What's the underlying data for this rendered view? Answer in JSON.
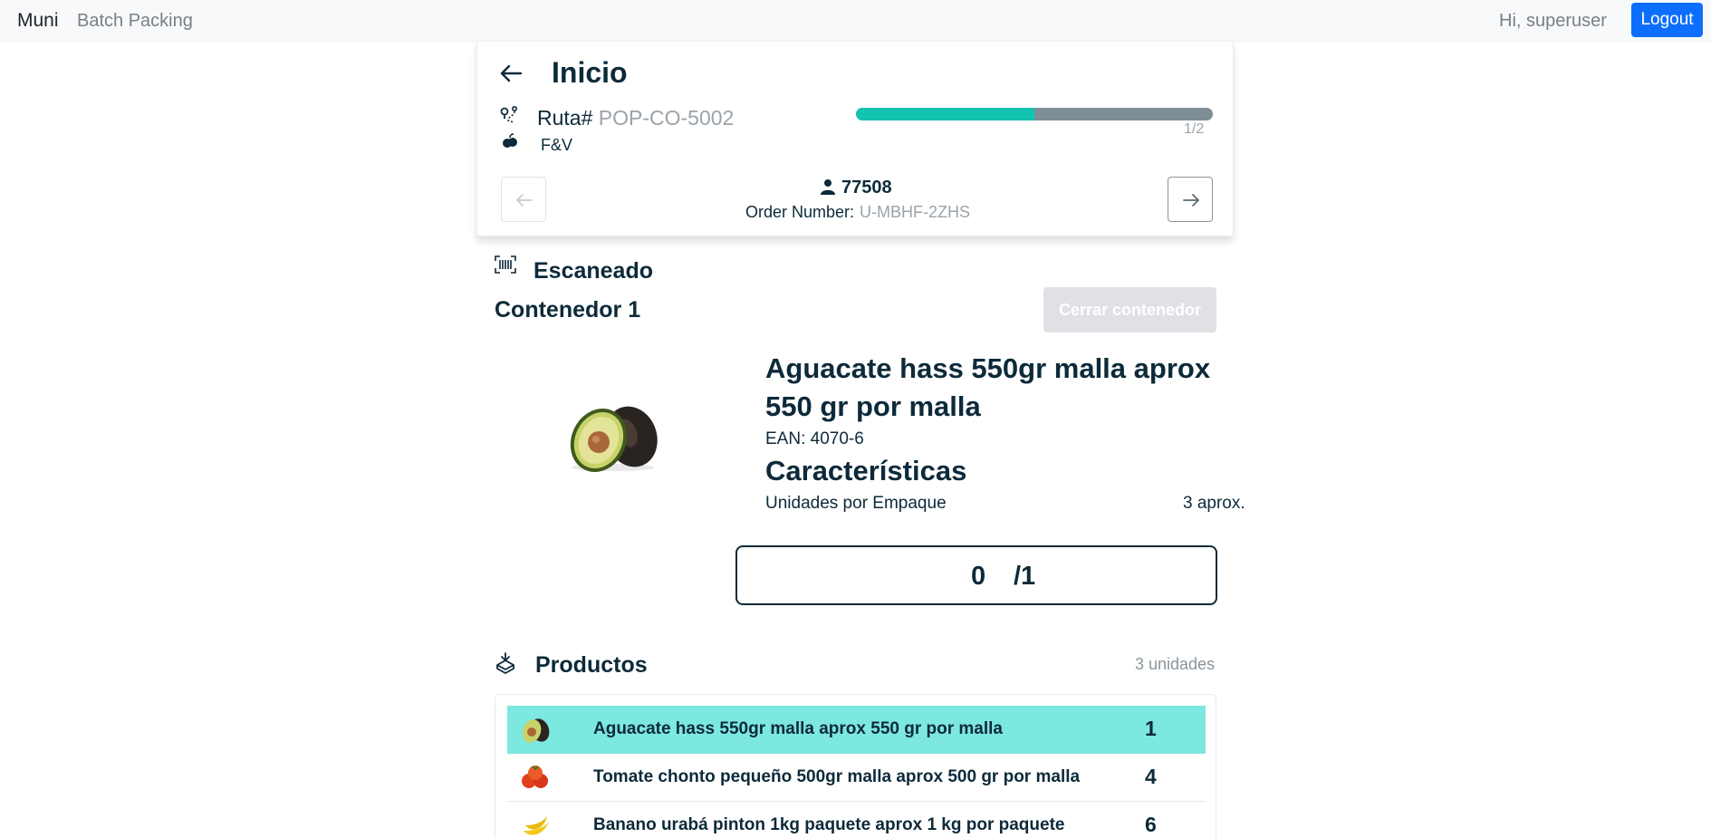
{
  "navbar": {
    "brand": "Muni",
    "link": "Batch Packing",
    "greeting": "Hi, superuser",
    "logout_label": "Logout"
  },
  "header": {
    "title": "Inicio",
    "route_label": "Ruta#",
    "route_value": "POP-CO-5002",
    "category": "F&V",
    "progress": {
      "current": 1,
      "total": 2,
      "fraction": 0.5,
      "text": "1/2"
    },
    "customer_id": "77508",
    "order_label": "Order Number:",
    "order_value": "U-MBHF-2ZHS"
  },
  "scan": {
    "title": "Escaneado",
    "container_title": "Contenedor 1",
    "close_label": "Cerrar contenedor",
    "product": {
      "name": "Aguacate hass 550gr malla aprox 550 gr por malla",
      "ean": "EAN: 4070-6",
      "features_title": "Características",
      "feature_label": "Unidades por Empaque",
      "feature_value": "3 aprox."
    },
    "counter": {
      "current": "0",
      "total": "/1"
    }
  },
  "products": {
    "title": "Productos",
    "count": "3 unidades",
    "items": [
      {
        "name": "Aguacate hass 550gr malla aprox 550 gr por malla",
        "qty": "1",
        "icon": "avocado-icon"
      },
      {
        "name": "Tomate chonto pequeño 500gr malla aprox 500 gr por malla",
        "qty": "4",
        "icon": "tomato-icon"
      },
      {
        "name": "Banano urabá pinton 1kg paquete aprox 1 kg por paquete",
        "qty": "6",
        "icon": "banana-icon"
      }
    ]
  },
  "colors": {
    "navy": "#0d2a3a",
    "teal": "#12c4b0",
    "highlight": "#7de8e0",
    "primary": "#0d6efd"
  }
}
